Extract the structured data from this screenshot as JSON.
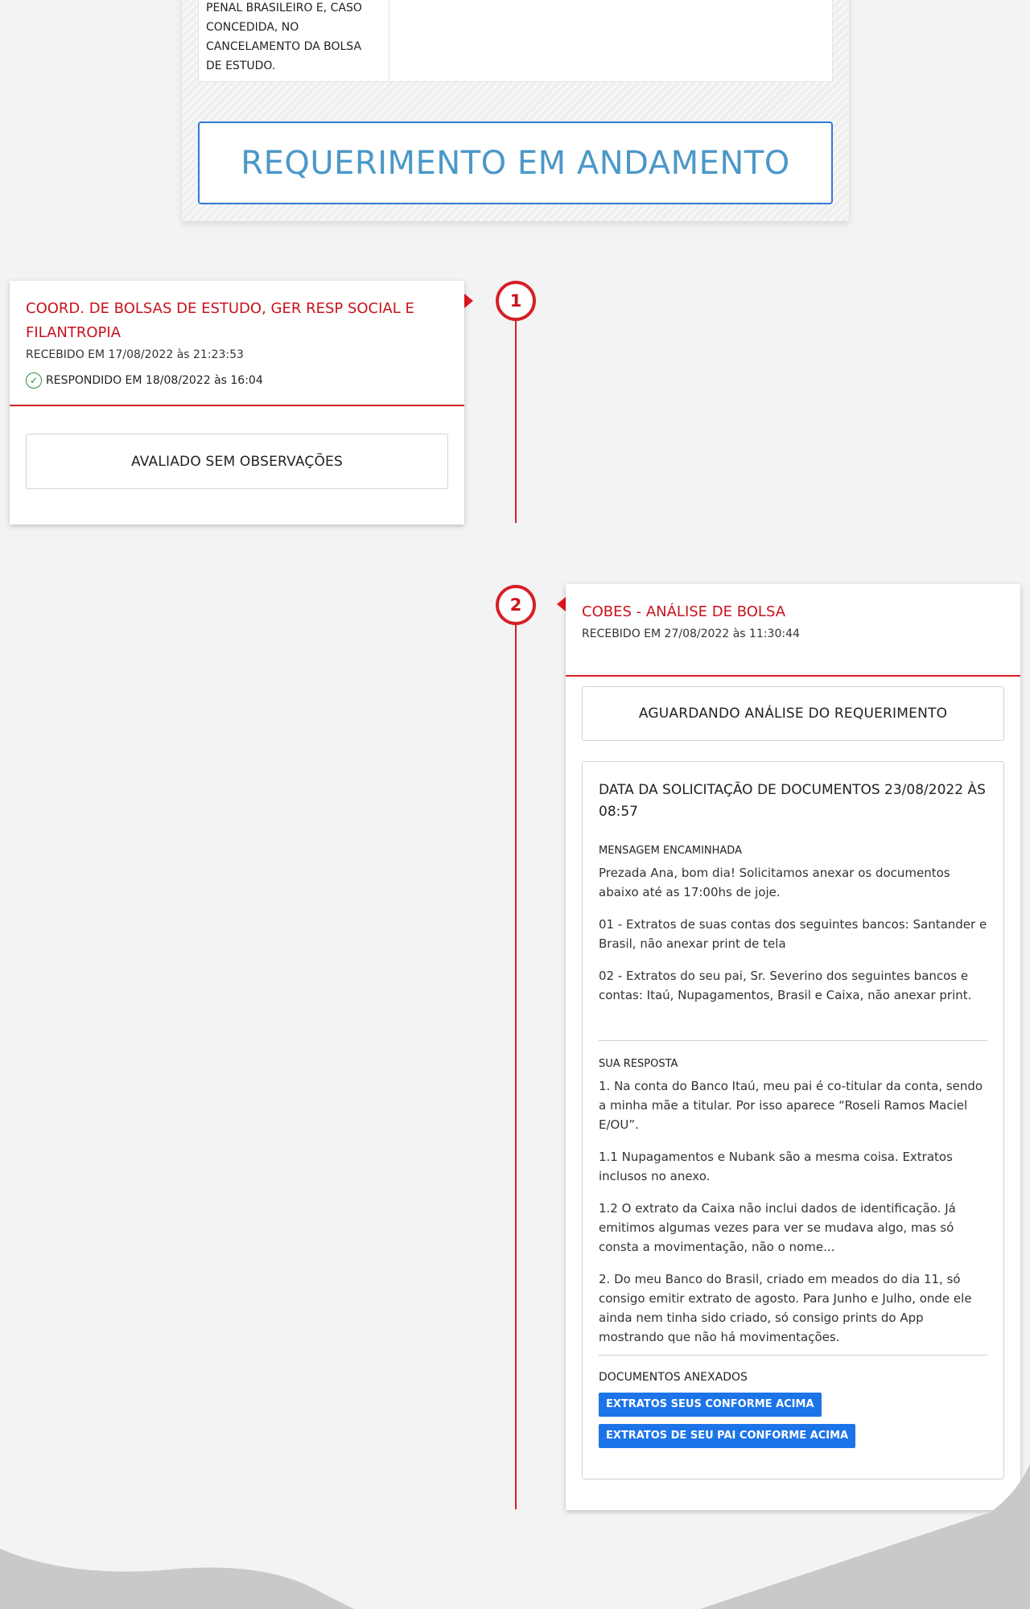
{
  "top_panel": {
    "cell_text": "PENAL BRASILEIRO E, CASO\nCONCEDIDA, NO\nCANCELAMENTO DA BOLSA\nDE ESTUDO.",
    "status_label": "REQUERIMENTO EM ANDAMENTO"
  },
  "timeline": [
    {
      "number": "1",
      "title": "COORD. DE BOLSAS DE ESTUDO, GER RESP SOCIAL E FILANTROPIA",
      "received": "RECEBIDO EM 17/08/2022 às 21:23:53",
      "responded": "RESPONDIDO EM 18/08/2022 às 16:04",
      "result": "AVALIADO SEM OBSERVAÇÕES"
    },
    {
      "number": "2",
      "title": "COBES - ANÁLISE DE BOLSA",
      "received": "RECEBIDO EM 27/08/2022 às 11:30:44",
      "result": "AGUARDANDO ANÁLISE DO REQUERIMENTO",
      "detail": {
        "title": "DATA DA SOLICITAÇÃO DE DOCUMENTOS 23/08/2022 ÀS 08:57",
        "message_label": "MENSAGEM ENCAMINHADA",
        "message_paragraphs": [
          "Prezada Ana, bom dia! Solicitamos anexar os documentos abaixo até as 17:00hs de joje.",
          "01 - Extratos de suas contas dos seguintes bancos: Santander e Brasil, não anexar print de tela",
          "02 - Extratos do seu pai, Sr. Severino dos seguintes bancos e contas: Itaú, Nupagamentos, Brasil e Caixa, não anexar print."
        ],
        "response_label": "SUA RESPOSTA",
        "response_paragraphs": [
          "1. Na conta do Banco Itaú, meu pai é co-titular da conta, sendo a minha mãe a titular. Por isso aparece “Roseli Ramos Maciel E/OU”.",
          "1.1 Nupagamentos e Nubank são a mesma coisa. Extratos inclusos no anexo.",
          "1.2 O extrato da Caixa não inclui dados de identificação. Já emitimos algumas vezes para ver se mudava algo, mas só consta a movimentação, não o nome...",
          "2. Do meu Banco do Brasil, criado em meados do dia 11, só consigo emitir extrato de agosto. Para Junho e Julho, onde ele ainda nem tinha sido criado, só consigo prints do App mostrando que não há movimentações."
        ],
        "documents_label": "DOCUMENTOS ANEXADOS",
        "documents": [
          "EXTRATOS SEUS CONFORME ACIMA",
          "EXTRATOS DE SEU PAI CONFORME ACIMA"
        ]
      }
    }
  ],
  "colors": {
    "accent_red": "#d61f26",
    "title_red": "#c8121c",
    "status_blue_border": "#2f7ad6",
    "status_blue_text": "#4b98c8",
    "doc_button_blue": "#1c74e8"
  },
  "icons": {
    "responded": "check-circle-icon"
  }
}
